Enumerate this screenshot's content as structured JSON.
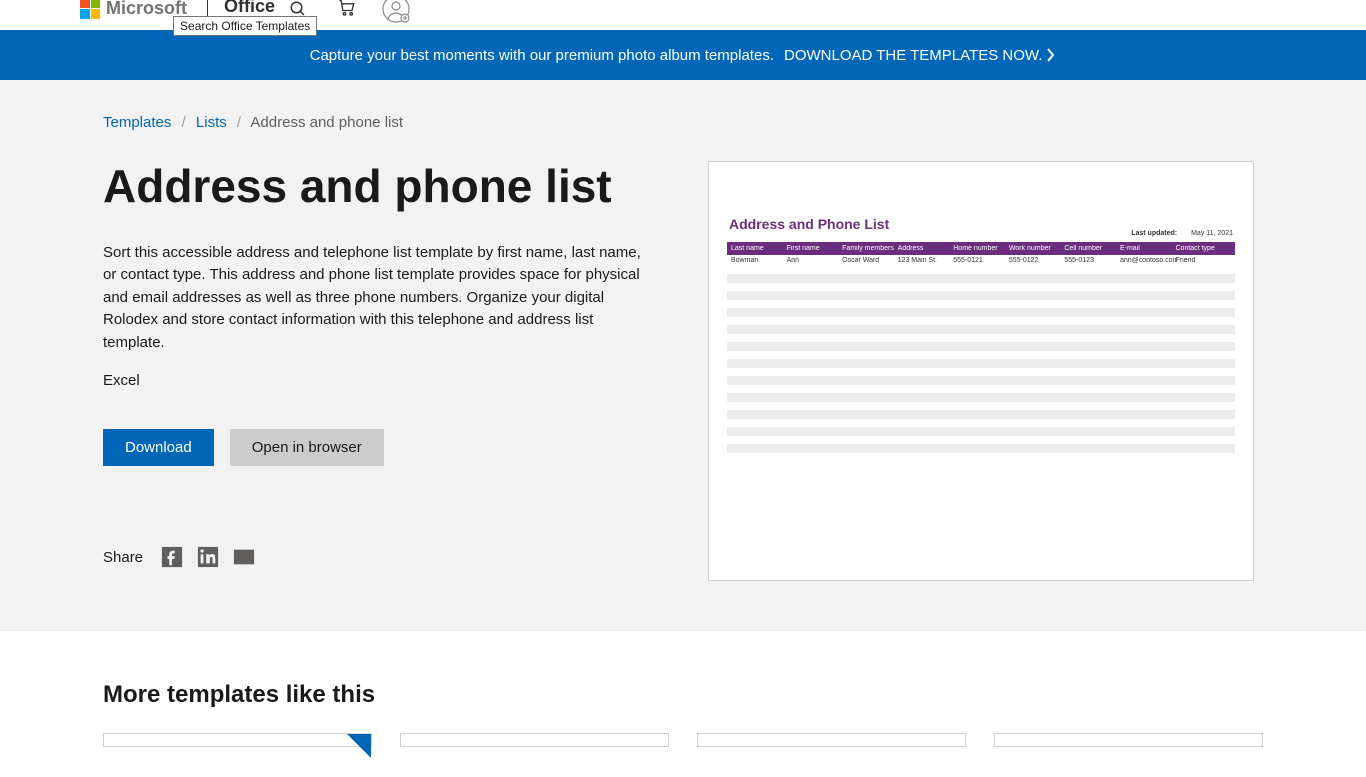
{
  "header": {
    "brand": "Microsoft",
    "product": "Office",
    "search_tooltip": "Search Office Templates"
  },
  "banner": {
    "text": "Capture your best moments with our premium photo album templates.",
    "cta": "DOWNLOAD THE TEMPLATES NOW."
  },
  "breadcrumb": {
    "templates": "Templates",
    "lists": "Lists",
    "current": "Address and phone list"
  },
  "page": {
    "title": "Address and phone list",
    "description": "Sort this accessible address and telephone list template by first name, last name, or contact type. This address and phone list template provides space for physical and email addresses as well as three phone numbers. Organize your digital Rolodex and store contact information with this telephone and address list template.",
    "app": "Excel",
    "download": "Download",
    "open": "Open in browser",
    "share": "Share"
  },
  "preview": {
    "title": "Address and Phone List",
    "updated_label": "Last updated:",
    "updated_date": "May 11, 2021",
    "headers": [
      "Last name",
      "First name",
      "Family members",
      "Address",
      "Home number",
      "Work number",
      "Cell number",
      "E-mail",
      "Contact type"
    ],
    "row": [
      "Bowman",
      "Ann",
      "Oscar Ward",
      "123 Main St.",
      "555-0121",
      "555-0122",
      "555-0123",
      "ann@contoso.com",
      "Friend"
    ]
  },
  "more": {
    "title": "More templates like this"
  }
}
